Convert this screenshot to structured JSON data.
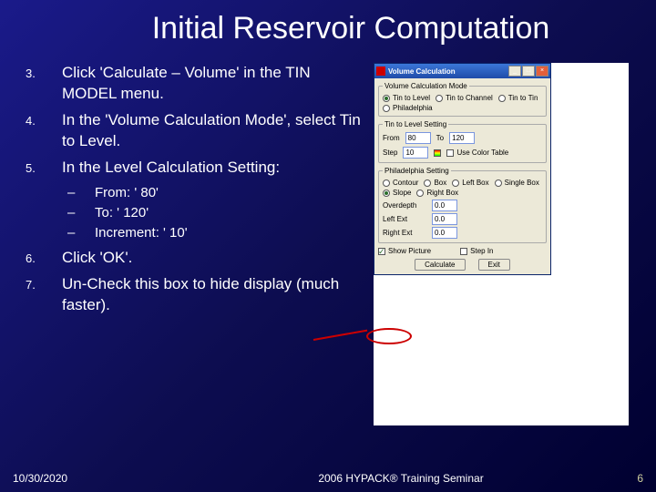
{
  "title": "Initial Reservoir Computation",
  "steps": [
    {
      "num": "3.",
      "text": "Click 'Calculate – Volume' in the TIN MODEL menu."
    },
    {
      "num": "4.",
      "text": "In the 'Volume Calculation Mode', select Tin to Level."
    },
    {
      "num": "5.",
      "text": "In the Level Calculation Setting:"
    }
  ],
  "substeps": [
    {
      "dash": "–",
      "text": "From: ' 80'"
    },
    {
      "dash": "–",
      "text": "To:  ' 120'"
    },
    {
      "dash": "–",
      "text": "Increment: ' 10'"
    }
  ],
  "steps2": [
    {
      "num": "6.",
      "text": "Click 'OK'."
    },
    {
      "num": "7.",
      "text": "Un-Check this box to hide display (much faster)."
    }
  ],
  "dialog": {
    "title": "Volume Calculation",
    "groups": {
      "mode": {
        "legend": "Volume Calculation Mode",
        "opts": [
          "Tin to Level",
          "Tin to Channel",
          "Tin to Tin",
          "Philadelphia"
        ],
        "selected": 0
      },
      "level": {
        "legend": "Tin to Level Setting",
        "from_lbl": "From",
        "from": "80",
        "to_lbl": "To",
        "to": "120",
        "step_lbl": "Step",
        "step": "10",
        "usecolor": "Use Color Table"
      },
      "phila": {
        "legend": "Philadelphia Setting",
        "opts": [
          "Contour",
          "Box",
          "Left Box",
          "Single Box",
          "Slope",
          "Right Box"
        ],
        "selected": 4,
        "ov_lbl": "Overdepth",
        "ov": "0.0",
        "le_lbl": "Left Ext",
        "le": "0.0",
        "re_lbl": "Right Ext",
        "re": "0.0"
      },
      "bottom": {
        "show": "Show Picture",
        "show_checked": true,
        "stepin": "Step In",
        "calc": "Calculate",
        "exit": "Exit"
      }
    }
  },
  "footer": {
    "date": "10/30/2020",
    "mid": "2006 HYPACK® Training Seminar",
    "page": "6"
  }
}
